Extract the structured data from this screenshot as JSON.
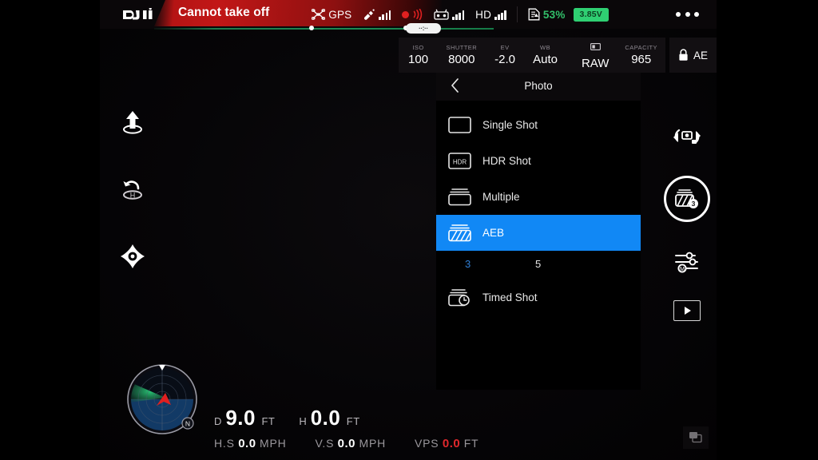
{
  "app": {
    "brand": "DJI",
    "warning_message": "Cannot take off",
    "accent_blue": "#1188f5",
    "status_green": "#2fcf72",
    "alert_red": "#c21717"
  },
  "statusbar": {
    "gps_label": "GPS",
    "satellite_tooltip": "··:··",
    "remote_signal_label": "",
    "hd_label": "HD",
    "battery_percent": "53%",
    "battery_voltage": "3.85V",
    "overflow_menu": "more-options",
    "icons": {
      "drone": "drone-icon",
      "satellite": "satellite-icon",
      "rec": "recording-icon",
      "controller": "remote-controller-icon",
      "hd": "hd-signal-icon",
      "sd_card": "sd-card-icon"
    }
  },
  "camera_settings": {
    "iso": {
      "label": "ISO",
      "value": "100"
    },
    "shutter": {
      "label": "SHUTTER",
      "value": "8000"
    },
    "ev": {
      "label": "EV",
      "value": "-2.0"
    },
    "wb": {
      "label": "WB",
      "value": "Auto"
    },
    "format": {
      "label": "",
      "value": "RAW"
    },
    "capacity": {
      "label": "CAPACITY",
      "value": "965"
    },
    "ae_lock": {
      "label": "AE"
    }
  },
  "photo_panel": {
    "title": "Photo",
    "back": "back",
    "items": [
      {
        "label": "Single Shot",
        "icon": "single-shot-icon",
        "selected": false
      },
      {
        "label": "HDR Shot",
        "icon": "hdr-shot-icon",
        "selected": false
      },
      {
        "label": "Multiple",
        "icon": "multiple-shot-icon",
        "selected": false
      },
      {
        "label": "AEB",
        "icon": "aeb-icon",
        "selected": true
      },
      {
        "label": "Timed Shot",
        "icon": "timed-shot-icon",
        "selected": false
      }
    ],
    "aeb_counts": [
      {
        "value": "3",
        "selected": true
      },
      {
        "value": "5",
        "selected": false
      }
    ]
  },
  "left_rail": [
    {
      "name": "takeoff-button",
      "icon": "takeoff-icon"
    },
    {
      "name": "return-to-home-button",
      "icon": "return-home-icon"
    },
    {
      "name": "intelligent-flight-button",
      "icon": "drone-modes-icon"
    }
  ],
  "right_rail": {
    "camera_video_toggle": "camera-video-toggle-icon",
    "shutter": {
      "icon": "aeb-shutter-icon",
      "badge": "3"
    },
    "settings": "camera-settings-icon",
    "playback": "playback-icon"
  },
  "telemetry": {
    "distance": {
      "key": "D",
      "value": "9.0",
      "unit": "FT"
    },
    "height": {
      "key": "H",
      "value": "0.0",
      "unit": "FT"
    },
    "horizontal_speed": {
      "key": "H.S",
      "value": "0.0",
      "unit": "MPH"
    },
    "vertical_speed": {
      "key": "V.S",
      "value": "0.0",
      "unit": "MPH"
    },
    "vps": {
      "key": "VPS",
      "value": "0.0",
      "unit": "FT"
    }
  },
  "radar": {
    "name": "attitude-radar",
    "north_label": "N"
  },
  "pip": {
    "name": "pip-toggle",
    "icon": "pip-icon"
  }
}
